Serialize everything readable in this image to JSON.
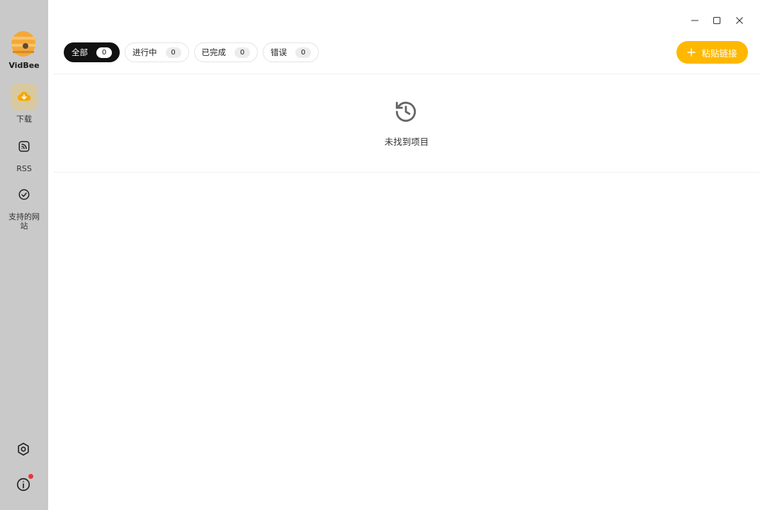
{
  "app": {
    "name": "VidBee"
  },
  "sidebar": {
    "items": [
      {
        "label": "下载",
        "icon": "download-cloud-icon",
        "active": true
      },
      {
        "label": "RSS",
        "icon": "rss-icon",
        "active": false
      },
      {
        "label": "支持的网站",
        "icon": "check-circle-icon",
        "active": false
      }
    ],
    "bottom": [
      {
        "icon": "settings-icon"
      },
      {
        "icon": "info-icon",
        "notification": true
      }
    ]
  },
  "window_controls": [
    "minimize-icon",
    "maximize-icon",
    "close-icon"
  ],
  "tabs": [
    {
      "label": "全部",
      "count": "0",
      "active": true
    },
    {
      "label": "进行中",
      "count": "0",
      "active": false
    },
    {
      "label": "已完成",
      "count": "0",
      "active": false
    },
    {
      "label": "错误",
      "count": "0",
      "active": false
    }
  ],
  "paste_button": {
    "label": "粘贴链接",
    "icon": "plus-icon"
  },
  "empty_state": {
    "icon": "history-icon",
    "text": "未找到项目"
  },
  "colors": {
    "accent": "#ffb800",
    "sidebar_bg": "#c9c9c9",
    "active_nav_bg": "#d9c9a1",
    "active_tab_bg": "#111111",
    "notification_dot": "#e5383b"
  }
}
